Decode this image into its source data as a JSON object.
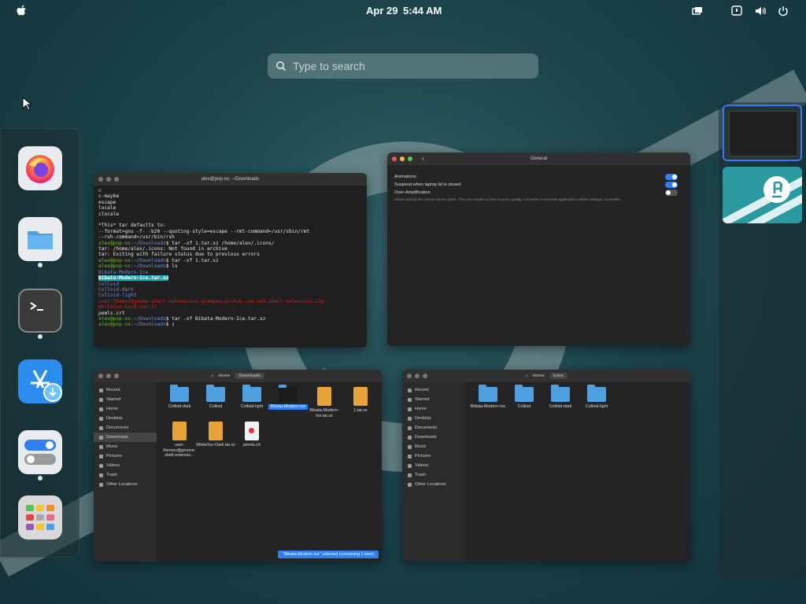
{
  "topbar": {
    "date": "Apr 29",
    "time": "5:44 AM"
  },
  "search": {
    "placeholder": "Type to search"
  },
  "dock": {
    "apps": [
      {
        "name": "Firefox",
        "running": false
      },
      {
        "name": "Files",
        "running": true
      },
      {
        "name": "Terminal",
        "running": true
      },
      {
        "name": "Pop!_Shop",
        "running": false
      },
      {
        "name": "Settings",
        "running": true
      },
      {
        "name": "Show Applications",
        "running": false
      }
    ]
  },
  "terminal_window": {
    "title": "alex@pop-os: ~/Downloads",
    "lines": [
      {
        "t": "c",
        "c": ""
      },
      {
        "t": "c-maybe",
        "c": ""
      },
      {
        "t": "escape",
        "c": ""
      },
      {
        "t": "locale",
        "c": ""
      },
      {
        "t": "clocale",
        "c": ""
      },
      {
        "t": " ",
        "c": ""
      },
      {
        "t": "*This* tar defaults to:",
        "c": ""
      },
      {
        "t": "--format=gnu -f- -b20 --quoting-style=escape --rmt-command=/usr/sbin/rmt",
        "c": ""
      },
      {
        "t": "--rsh-command=/usr/bin/rsh",
        "c": ""
      },
      {
        "t": "alex@pop-os:~/Downloads$ tar -xf 1.tar.xz /home/alex/.icons/",
        "c": "prompt"
      },
      {
        "t": "tar: /home/alex/.icons: Not found in archive",
        "c": ""
      },
      {
        "t": "tar: Exiting with failure status due to previous errors",
        "c": ""
      },
      {
        "t": "alex@pop-os:~/Downloads$ tar -xf 1.tar.xz",
        "c": "prompt"
      },
      {
        "t": "alex@pop-os:~/Downloads$ ls",
        "c": "prompt"
      },
      {
        "t": "Bibata-Modern-Ice",
        "c": "blue"
      },
      {
        "t": "Bibata-Modern-Ice.tar.xz",
        "c": "hl"
      },
      {
        "t": "Colloid",
        "c": "blue"
      },
      {
        "t": "Colloid-dark",
        "c": "blue"
      },
      {
        "t": "Colloid-light",
        "c": "blue"
      },
      {
        "t": "user-themes@gnome-shell-extensions.gcampax.github.com.v49.shell-extension.zip",
        "c": "red"
      },
      {
        "t": "WhiteSur-Dark.tar.xz",
        "c": "red"
      },
      {
        "t": "pemls.crt",
        "c": ""
      },
      {
        "t": "alex@pop-os:~/Downloads$ tar -xf Bibata-Modern-Ice.tar.xz",
        "c": "prompt"
      },
      {
        "t": "alex@pop-os:~/Downloads$ ",
        "c": "prompt"
      }
    ]
  },
  "settings_window": {
    "title": "General",
    "rows": [
      {
        "label": "Animations",
        "on": true
      },
      {
        "label": "Suspend when laptop lid is closed",
        "on": true
      },
      {
        "label": "Over-Amplification",
        "on": false
      }
    ],
    "description": "Allows raising the volume above 100%. This can result in a loss of audio quality; it is better to increase application volume settings, if possible."
  },
  "files_left": {
    "path_home": "Home",
    "path_current": "Downloads",
    "sidebar": [
      "Recent",
      "Starred",
      "Home",
      "Desktop",
      "Documents",
      "Downloads",
      "Music",
      "Pictures",
      "Videos",
      "Trash",
      "Other Locations"
    ],
    "selected": "Downloads",
    "items": [
      {
        "name": "Colloid-dark",
        "kind": "folder"
      },
      {
        "name": "Colloid",
        "kind": "folder"
      },
      {
        "name": "Colloid-light",
        "kind": "folder"
      },
      {
        "name": "Bibata-Modern-Ice",
        "kind": "folder-dark"
      },
      {
        "name": "Bibata-Modern-Ice.tar.xz",
        "kind": "archive"
      },
      {
        "name": "1.tar.xz",
        "kind": "archive"
      },
      {
        "name": "user-themes@gnome-shell-extensio...",
        "kind": "archive"
      },
      {
        "name": "WhiteSur-Dark.tar.xz",
        "kind": "archive"
      },
      {
        "name": "pemls.crt",
        "kind": "cert"
      }
    ],
    "status": "\"Bibata-Modern-Ice\" selected (containing 1 item)"
  },
  "files_right": {
    "path_home": "Home",
    "path_current": "icons",
    "sidebar": [
      "Recent",
      "Starred",
      "Home",
      "Desktop",
      "Documents",
      "Downloads",
      "Music",
      "Pictures",
      "Videos",
      "Trash",
      "Other Locations"
    ],
    "items": [
      {
        "name": "Bibata-Modern-Ice",
        "kind": "folder"
      },
      {
        "name": "Colloid",
        "kind": "folder"
      },
      {
        "name": "Colloid-dark",
        "kind": "folder"
      },
      {
        "name": "Colloid-light",
        "kind": "folder"
      }
    ]
  },
  "workspaces": [
    {
      "active": true
    },
    {
      "active": false
    }
  ],
  "colors": {
    "accent": "#2f7ef2",
    "terminal_prompt": "#6cbf2f",
    "terminal_dir": "#6f8fd8"
  }
}
